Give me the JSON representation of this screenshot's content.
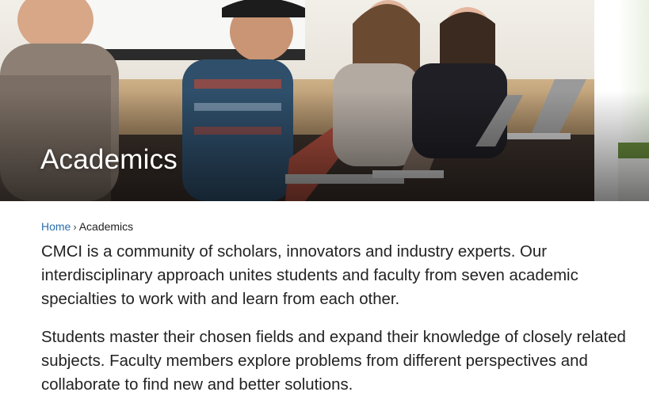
{
  "hero": {
    "title": "Academics"
  },
  "breadcrumb": {
    "home_label": "Home",
    "separator": "›",
    "current_label": "Academics"
  },
  "content": {
    "paragraphs": [
      "CMCI is a community of scholars, innovators and industry experts. Our interdisciplinary approach unites students and faculty from seven academic specialties to work with and learn from each other.",
      "Students master their chosen fields and expand their knowledge of closely related subjects. Faculty members explore problems from different perspectives and collaborate to find new and better solutions."
    ]
  },
  "colors": {
    "link": "#2a6eb0",
    "body_text": "#222222",
    "hero_title": "#ffffff"
  }
}
